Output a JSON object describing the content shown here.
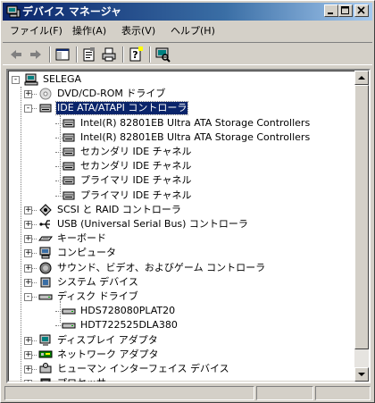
{
  "window": {
    "title": "デバイス マネージャ",
    "buttons": {
      "minimize": "minimize",
      "maximize": "maximize",
      "close": "close"
    }
  },
  "menu": [
    {
      "label": "ファイル(F)"
    },
    {
      "label": "操作(A)"
    },
    {
      "label": "表示(V)"
    },
    {
      "label": "ヘルプ(H)"
    }
  ],
  "toolbar": {
    "items": [
      "back-icon",
      "forward-icon",
      "show-hide-console-tree-icon",
      "properties-icon",
      "print-icon",
      "help-icon",
      "scan-hardware-icon"
    ]
  },
  "tree": {
    "root": "SELEGA",
    "items": [
      {
        "label": "DVD/CD-ROM ドライブ",
        "level": 1,
        "expander": "+",
        "icon": "dvd-icon"
      },
      {
        "label": "IDE ATA/ATAPI コントローラ",
        "level": 1,
        "expander": "-",
        "icon": "ide-controller-icon",
        "selected": true
      },
      {
        "label": "Intel(R) 82801EB Ultra ATA Storage Controllers",
        "level": 2,
        "icon": "ide-controller-icon"
      },
      {
        "label": "Intel(R) 82801EB Ultra ATA Storage Controllers",
        "level": 2,
        "icon": "ide-controller-icon"
      },
      {
        "label": "セカンダリ IDE チャネル",
        "level": 2,
        "icon": "ide-controller-icon"
      },
      {
        "label": "セカンダリ IDE チャネル",
        "level": 2,
        "icon": "ide-controller-icon"
      },
      {
        "label": "プライマリ IDE チャネル",
        "level": 2,
        "icon": "ide-controller-icon"
      },
      {
        "label": "プライマリ IDE チャネル",
        "level": 2,
        "icon": "ide-controller-icon"
      },
      {
        "label": "SCSI と RAID コントローラ",
        "level": 1,
        "expander": "+",
        "icon": "scsi-icon"
      },
      {
        "label": "USB (Universal Serial Bus) コントローラ",
        "level": 1,
        "expander": "+",
        "icon": "usb-icon"
      },
      {
        "label": "キーボード",
        "level": 1,
        "expander": "+",
        "icon": "keyboard-icon"
      },
      {
        "label": "コンピュータ",
        "level": 1,
        "expander": "+",
        "icon": "computer-icon"
      },
      {
        "label": "サウンド、ビデオ、およびゲーム コントローラ",
        "level": 1,
        "expander": "+",
        "icon": "sound-icon"
      },
      {
        "label": "システム デバイス",
        "level": 1,
        "expander": "+",
        "icon": "system-device-icon"
      },
      {
        "label": "ディスク ドライブ",
        "level": 1,
        "expander": "-",
        "icon": "disk-drive-icon"
      },
      {
        "label": "HDS728080PLAT20",
        "level": 2,
        "icon": "disk-drive-icon"
      },
      {
        "label": "HDT722525DLA380",
        "level": 2,
        "icon": "disk-drive-icon"
      },
      {
        "label": "ディスプレイ アダプタ",
        "level": 1,
        "expander": "+",
        "icon": "display-adapter-icon"
      },
      {
        "label": "ネットワーク アダプタ",
        "level": 1,
        "expander": "+",
        "icon": "network-adapter-icon"
      },
      {
        "label": "ヒューマン インターフェイス デバイス",
        "level": 1,
        "expander": "+",
        "icon": "hid-icon"
      },
      {
        "label": "プロセッサ",
        "level": 1,
        "expander": "+",
        "icon": "processor-icon"
      }
    ]
  },
  "colors": {
    "titlebar_start": "#0a246a",
    "titlebar_end": "#a6caf0",
    "selection": "#0a246a",
    "face": "#d4d0c8"
  }
}
